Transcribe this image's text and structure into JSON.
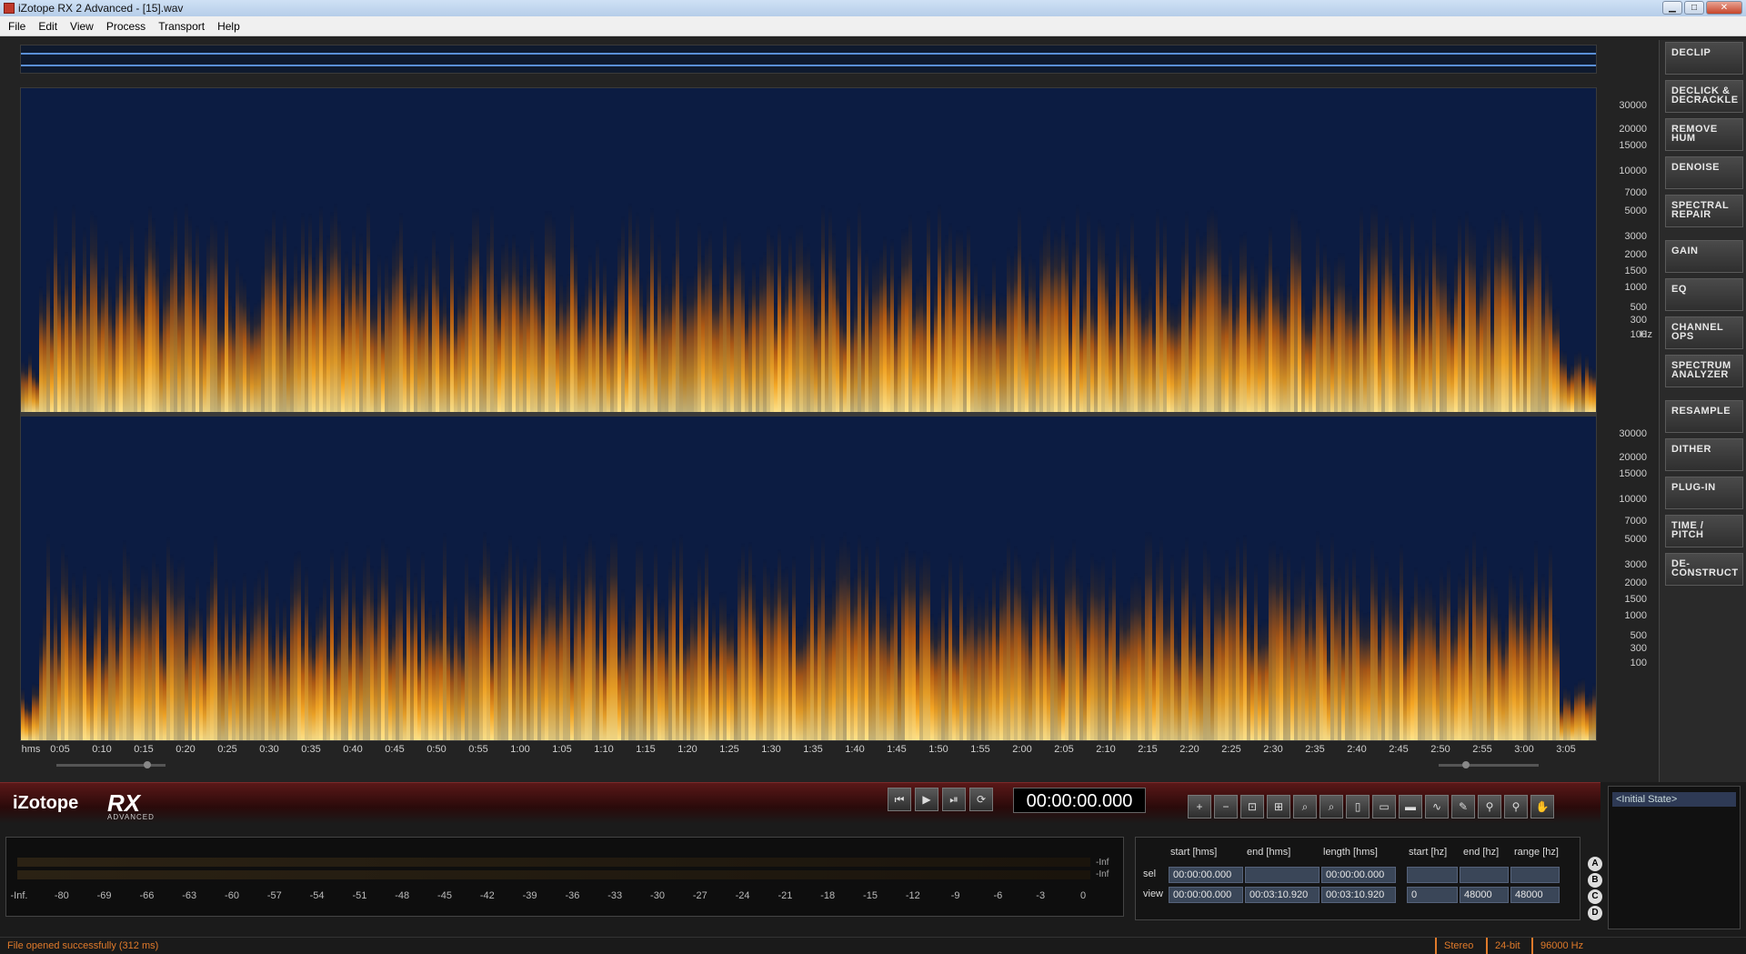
{
  "window": {
    "title": "iZotope RX 2 Advanced - [15].wav",
    "controls": [
      "minimize",
      "maximize",
      "close"
    ]
  },
  "menu": [
    "File",
    "Edit",
    "View",
    "Process",
    "Transport",
    "Help"
  ],
  "spectrogram": {
    "freq_labels": [
      "30000",
      "20000",
      "15000",
      "10000",
      "7000",
      "5000",
      "3000",
      "2000",
      "1500",
      "1000",
      "500",
      "300",
      "100"
    ],
    "freq_unit": "Hz",
    "time_unit": "hms",
    "time_labels": [
      "0:05",
      "0:10",
      "0:15",
      "0:20",
      "0:25",
      "0:30",
      "0:35",
      "0:40",
      "0:45",
      "0:50",
      "0:55",
      "1:00",
      "1:05",
      "1:10",
      "1:15",
      "1:20",
      "1:25",
      "1:30",
      "1:35",
      "1:40",
      "1:45",
      "1:50",
      "1:55",
      "2:00",
      "2:05",
      "2:10",
      "2:15",
      "2:20",
      "2:25",
      "2:30",
      "2:35",
      "2:40",
      "2:45",
      "2:50",
      "2:55",
      "3:00",
      "3:05"
    ]
  },
  "modules": [
    "DECLIP",
    "DECLICK &\nDECRACKLE",
    "REMOVE\nHUM",
    "DENOISE",
    "SPECTRAL\nREPAIR",
    "GAIN",
    "EQ",
    "CHANNEL\nOPS",
    "SPECTRUM\nANALYZER",
    "RESAMPLE",
    "DITHER",
    "PLUG-IN",
    "TIME /\nPITCH",
    "DE-\nCONSTRUCT"
  ],
  "brand": {
    "logo_text": "iZotope",
    "product": "RX",
    "edition": "ADVANCED"
  },
  "transport": {
    "buttons": [
      "skip-to-start",
      "play",
      "play-selection",
      "loop"
    ],
    "timecode": "00:00:00.000"
  },
  "history": {
    "items": [
      "<Initial State>"
    ]
  },
  "meter": {
    "labels": [
      "-Inf.",
      "-80",
      "-69",
      "-66",
      "-63",
      "-60",
      "-57",
      "-54",
      "-51",
      "-48",
      "-45",
      "-42",
      "-39",
      "-36",
      "-33",
      "-30",
      "-27",
      "-24",
      "-21",
      "-18",
      "-15",
      "-12",
      "-9",
      "-6",
      "-3",
      "0"
    ],
    "inf_top": "-Inf",
    "inf_bottom": "-Inf"
  },
  "selection": {
    "headers": [
      "start [hms]",
      "end [hms]",
      "length [hms]",
      "start [hz]",
      "end [hz]",
      "range [hz]"
    ],
    "sel_label": "sel",
    "view_label": "view",
    "sel": [
      "00:00:00.000",
      "",
      "00:00:00.000",
      "",
      "",
      ""
    ],
    "view": [
      "00:00:00.000",
      "00:03:10.920",
      "00:03:10.920",
      "0",
      "48000",
      "48000"
    ]
  },
  "abcd": [
    "A",
    "B",
    "C",
    "D"
  ],
  "status": {
    "message": "File opened successfully (312 ms)",
    "channels": "Stereo",
    "bit_depth": "24-bit",
    "sample_rate": "96000 Hz"
  },
  "colors": {
    "spectrum_hot": "#f5a623",
    "spectrum_cold": "#0a1a40",
    "brand_red": "#5a1818",
    "status_orange": "#e07a2a"
  }
}
